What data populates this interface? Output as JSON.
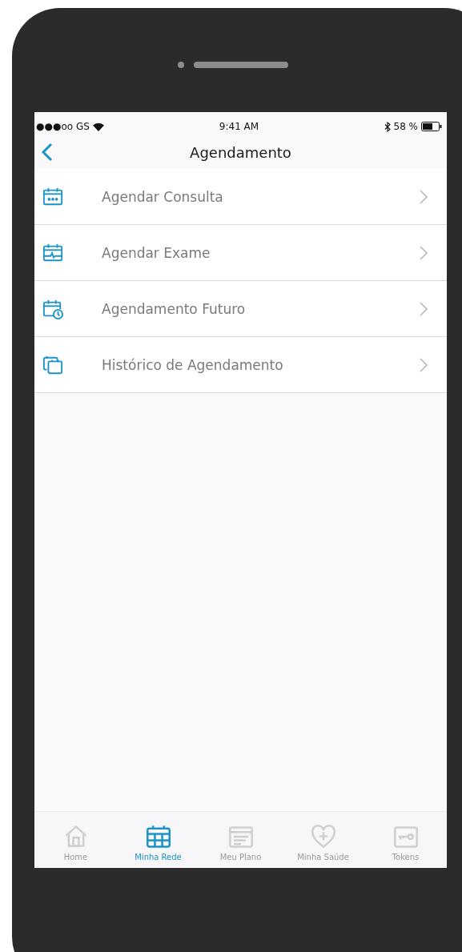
{
  "status_bar": {
    "carrier": "●●●oo GS",
    "time": "9:41 AM",
    "battery": "58 %"
  },
  "nav_bar": {
    "title": "Agendamento"
  },
  "menu_items": [
    {
      "label": "Agendar Consulta"
    },
    {
      "label": "Agendar Exame"
    },
    {
      "label": "Agendamento Futuro"
    },
    {
      "label": "Histórico de Agendamento"
    }
  ],
  "tab_bar": [
    {
      "label": "Home",
      "selected": false
    },
    {
      "label": "Minha Rede",
      "selected": true
    },
    {
      "label": "Meu Plano",
      "selected": false
    },
    {
      "label": "Minha Saúde",
      "selected": false
    },
    {
      "label": "Tokens",
      "selected": false
    }
  ]
}
